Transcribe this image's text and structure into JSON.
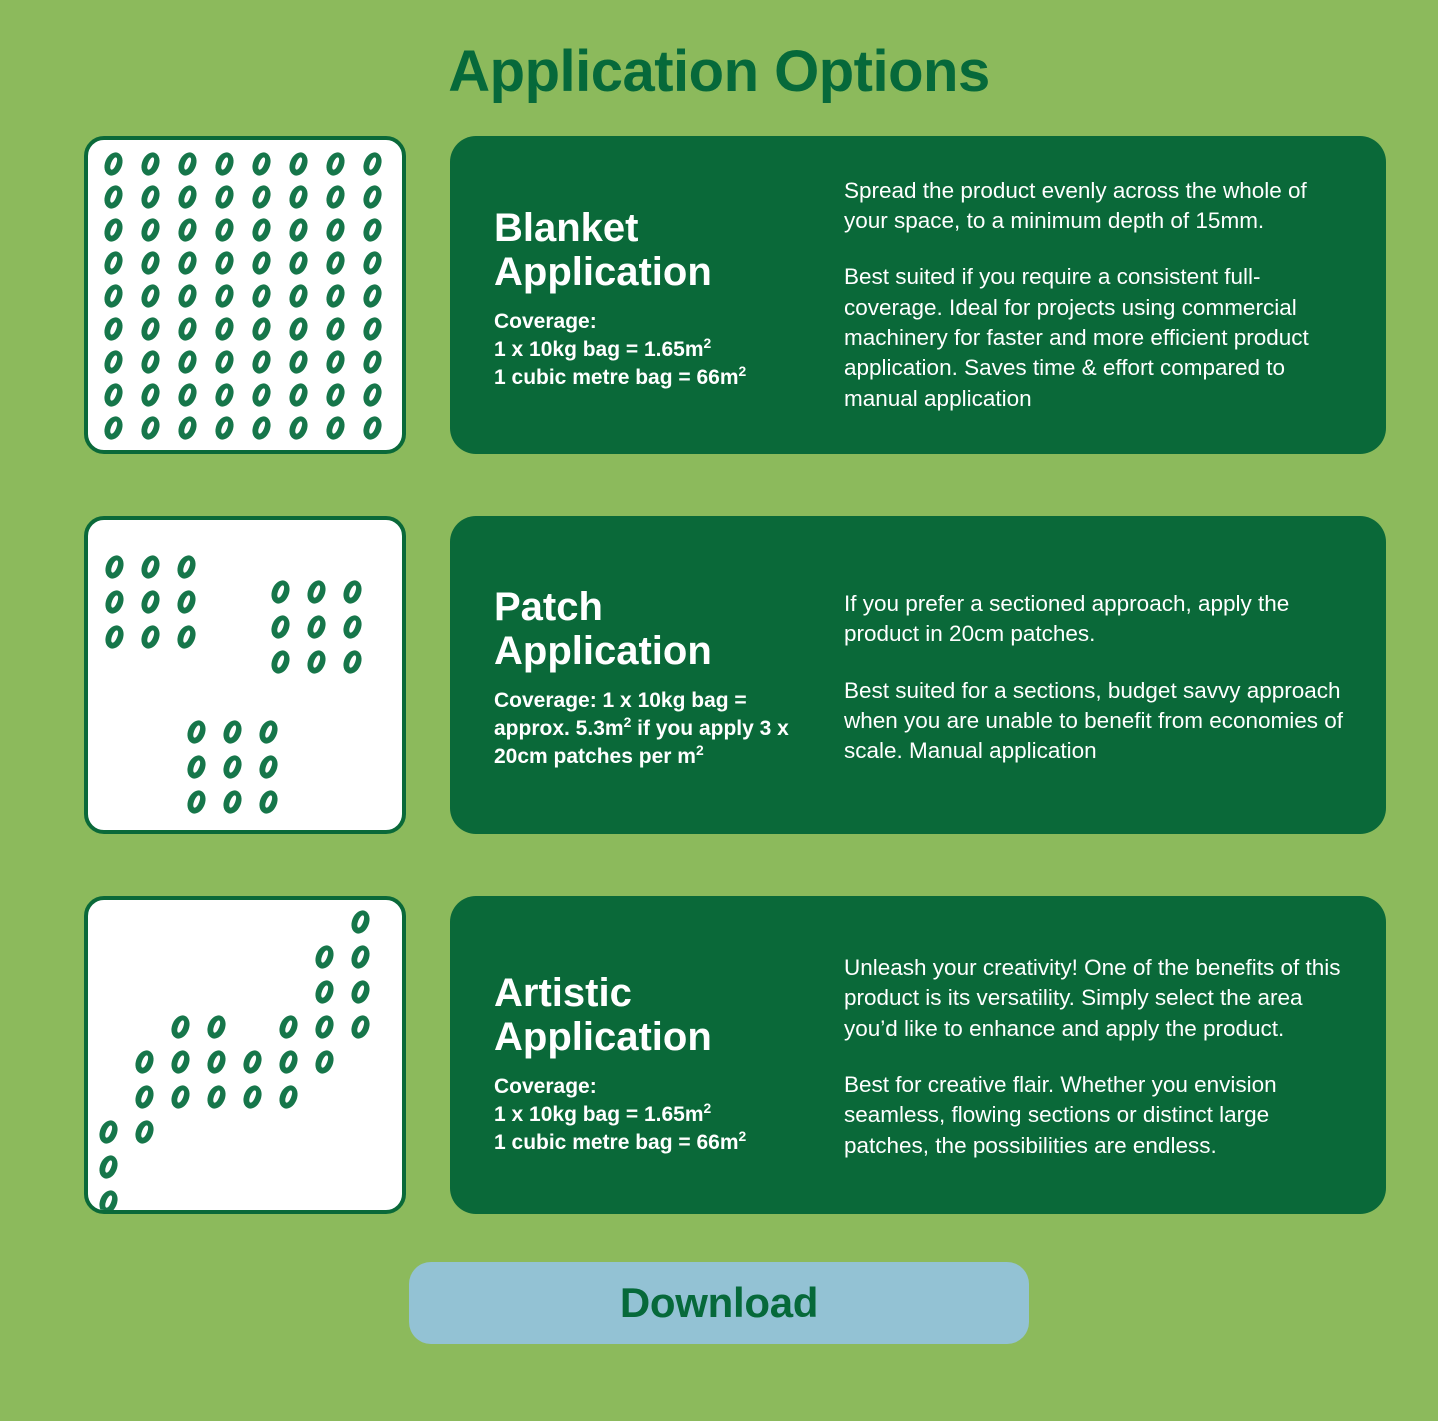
{
  "page": {
    "title": "Application Options",
    "background_color": "#8cba5c",
    "title_color": "#06693a",
    "card_color": "#0a6939",
    "pattern_box_color": "#ffffff",
    "seed_color": "#16764a",
    "button_color": "#93c2d4"
  },
  "cards": [
    {
      "id": "blanket",
      "heading": "Blanket\nApplication",
      "coverage": "Coverage:\n1 x 10kg bag = 1.65m²\n1 cubic metre bag = 66m²",
      "paragraph_1": "Spread the product evenly across the whole of your space, to a minimum depth of 15mm.",
      "paragraph_2": "Best suited if you require a consistent full-coverage. Ideal for projects using commercial machinery for faster and more efficient product application. Saves time & effort compared to manual application",
      "pattern_name": "blanket-full-grid",
      "pattern": {
        "type": "grid",
        "columns": 8,
        "rows": 9,
        "origin": [
          17,
          12
        ],
        "step": [
          37,
          33
        ]
      }
    },
    {
      "id": "patch",
      "heading": "Patch\nApplication",
      "coverage": "Coverage: 1 x 10kg bag = approx. 5.3m² if you apply 3 x 20cm patches per m²",
      "paragraph_1": "If you prefer a sectioned approach, apply the product in 20cm patches.",
      "paragraph_2": "Best suited for a sections, budget savvy approach when you are unable to benefit from economies of scale. Manual application",
      "pattern_name": "patch-three-clusters",
      "pattern": {
        "type": "clusters",
        "cluster_size": [
          3,
          3
        ],
        "step": [
          36,
          35
        ],
        "clusters": [
          [
            18,
            35
          ],
          [
            184,
            60
          ],
          [
            100,
            200
          ]
        ]
      }
    },
    {
      "id": "artistic",
      "heading": "Artistic\nApplication",
      "coverage": "Coverage:\n1 x 10kg bag = 1.65m²\n1 cubic metre bag = 66m²",
      "paragraph_1": "Unleash your creativity! One of the benefits of this product is its versatility. Simply select the area you’d like to enhance and apply the product.",
      "paragraph_2": "Best for creative flair. Whether you envision seamless, flowing sections or distinct large patches, the possibilities are endless.",
      "pattern_name": "artistic-diagonal-flow",
      "pattern": {
        "type": "cells",
        "origin": [
          12,
          10
        ],
        "step": [
          36,
          35
        ],
        "cells": [
          [
            7,
            0
          ],
          [
            6,
            1
          ],
          [
            7,
            1
          ],
          [
            6,
            2
          ],
          [
            7,
            2
          ],
          [
            2,
            3
          ],
          [
            3,
            3
          ],
          [
            5,
            3
          ],
          [
            6,
            3
          ],
          [
            7,
            3
          ],
          [
            1,
            4
          ],
          [
            2,
            4
          ],
          [
            3,
            4
          ],
          [
            4,
            4
          ],
          [
            5,
            4
          ],
          [
            6,
            4
          ],
          [
            1,
            5
          ],
          [
            2,
            5
          ],
          [
            3,
            5
          ],
          [
            4,
            5
          ],
          [
            5,
            5
          ],
          [
            0,
            6
          ],
          [
            1,
            6
          ],
          [
            0,
            7
          ],
          [
            0,
            8
          ]
        ]
      }
    }
  ],
  "download_button": {
    "label": "Download"
  }
}
